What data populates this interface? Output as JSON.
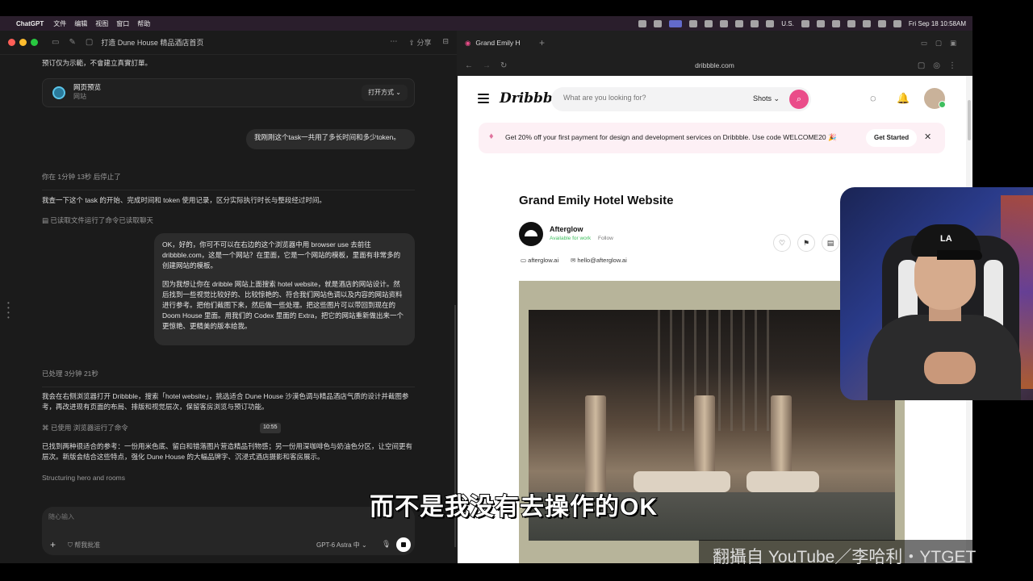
{
  "menubar": {
    "app": "ChatGPT",
    "menus": [
      "文件",
      "编辑",
      "视图",
      "窗口",
      "帮助"
    ],
    "input_source": "U.S.",
    "clock": "Fri Sep 18  10:58AM"
  },
  "chat": {
    "title": "打造 Dune House 精品酒店首页",
    "share": "分享",
    "intro_text": "预订仅为示範，不會建立真實訂單。",
    "card": {
      "title": "网页预览",
      "subtitle": "网站",
      "open_label": "打开方式"
    },
    "user_msg1": "我刚刚这个task一共用了多长时间和多少token。",
    "stopped_after": "你在 1分钟 13秒 后停止了",
    "assistant_msg1": "我查一下这个 task 的开始、完成时间和 token 使用记录，区分实际执行时长与整段经过时间。",
    "tool_read": "已读取文件运行了命令已读取聊天",
    "user_msg2_p1": "OK，好的，你可不可以在右边的这个浏览器中用 browser use 去前往 dribbble.com，这是一个网站？在里面，它是一个网站的模板，里面有非常多的创建网站的模板。",
    "user_msg2_p2": "因为我想让你在 dribble 网站上面搜索 hotel website，就是酒店的网站设计。然后找到一些视觉比较好的、比较惊艳的、符合我们网站色调以及内容的网站资料进行参考。把他们截图下来，然后做一些处理。把这些图片可以带回到现在的 Doom House 里面。用我们的 Codex 里面的 Extra，把它的网站重新做出来一个更惊艳、更精美的版本给我。",
    "processed": "已处理 3分钟 21秒",
    "assistant_msg2": "我会在右侧浏览器打开 Dribbble，搜索「hotel website」，挑选适合 Dune House 沙漠色调与精品酒店气质的设计并截图参考，再改进现有页面的布局、排版和视觉层次，保留客房浏览与预订功能。",
    "tool_browser": "已使用 浏览器运行了命令",
    "tooltip_time": "10:55",
    "assistant_msg3": "已找到两种很适合的参考：一份用米色底、留白和错落图片营造精品刊物感；另一份用深咖啡色与奶油色分区，让空间更有层次。新版会结合这些特点，强化 Dune House 的大幅品牌字、沉浸式酒店摄影和客房展示。",
    "status_working": "Structuring hero and rooms",
    "composer": {
      "placeholder": "随心输入",
      "permissions": "帮我批准",
      "model": "GPT-6 Astra 中"
    }
  },
  "browser": {
    "tab_title": "Grand Emily H",
    "url": "dribbble.com",
    "page": {
      "logo": "Dribbble",
      "search_placeholder": "What are you looking for?",
      "search_filter": "Shots",
      "promo_text": "Get 20% off your first payment for design and development services on Dribbble. Use code WELCOME20 🎉",
      "promo_cta": "Get Started",
      "shot_title": "Grand Emily Hotel Website",
      "author": "Afterglow",
      "availability": "Available for work",
      "follow": "Follow",
      "website": "afterglow.ai",
      "email": "hello@afterglow.ai"
    }
  },
  "overlay": {
    "subtitle": "而不是我没有去操作的OK",
    "watermark": "翻攝自 YouTube／李哈利・YTGET"
  },
  "colors": {
    "dribbble_pink": "#ea4c89",
    "promo_bg": "#fdf0f5",
    "available_green": "#3fbf5f",
    "chat_bg": "#1b1b1b"
  }
}
